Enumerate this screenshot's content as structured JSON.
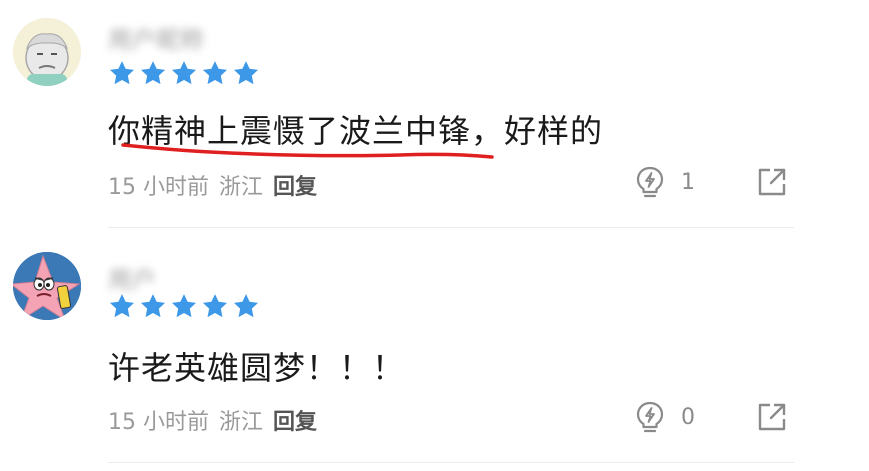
{
  "comments": [
    {
      "username": "用户昵称",
      "rating": 5,
      "text": "你精神上震慑了波兰中锋，好样的",
      "time": "15 小时前",
      "location": "浙江",
      "reply_label": "回复",
      "likes": "1",
      "avatar_icon": "grandpa-avatar-icon"
    },
    {
      "username": "用户",
      "rating": 5,
      "text": "许老英雄圆梦！！！",
      "time": "15 小时前",
      "location": "浙江",
      "reply_label": "回复",
      "likes": "0",
      "avatar_icon": "patrick-star-avatar-icon"
    }
  ],
  "colors": {
    "star": "#3d98e8",
    "underline": "#e02020",
    "meta_text": "#9a9a9a",
    "icon": "#8a8a8a"
  }
}
